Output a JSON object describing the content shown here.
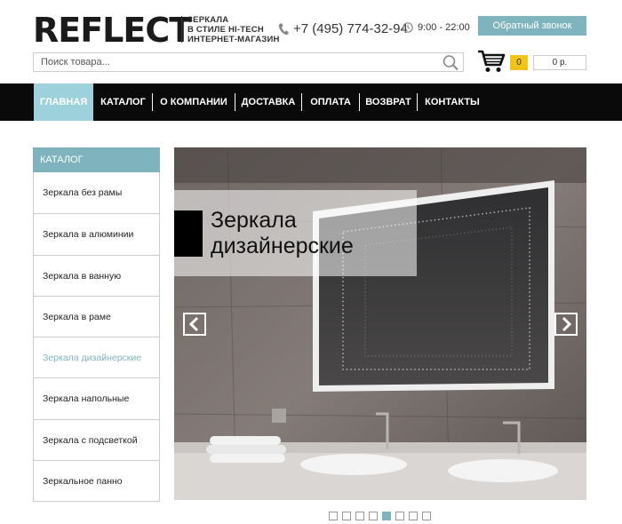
{
  "brand": {
    "logo": "REFLECT",
    "tagline_line1": "ЗЕРКАЛА",
    "tagline_line2": "В СТИЛЕ HI-TECH",
    "tagline_line3": "ИНТЕРНЕТ-МАГАЗИН"
  },
  "contact": {
    "phone": "+7 (495) 774-32-94",
    "hours": "9:00 - 22:00",
    "callback_label": "Обратный звонок"
  },
  "search": {
    "placeholder": "Поиск товара..."
  },
  "cart": {
    "count": "0",
    "total": "0 р."
  },
  "nav": {
    "items": [
      "ГЛАВНАЯ",
      "КАТАЛОГ",
      "О КОМПАНИИ",
      "ДОСТАВКА",
      "ОПЛАТА",
      "ВОЗВРАТ",
      "КОНТАКТЫ"
    ],
    "active_index": 0
  },
  "sidebar": {
    "title": "КАТАЛОГ",
    "items": [
      "Зеркала без рамы",
      "Зеркала в алюминии",
      "Зеркала в ванную",
      "Зеркала в раме",
      "Зеркала дизайнерские",
      "Зеркала напольные",
      "Зеркала с подсветкой",
      "Зеркальное панно"
    ],
    "active_index": 4
  },
  "slider": {
    "caption_line1": "Зеркала",
    "caption_line2": "дизайнерские",
    "slide_count": 8,
    "active_slide": 4
  },
  "colors": {
    "accent": "#7fb4bf",
    "nav_active": "#9dd1db",
    "nav_bg": "#0a0a0a",
    "cart_badge": "#f0c419"
  }
}
